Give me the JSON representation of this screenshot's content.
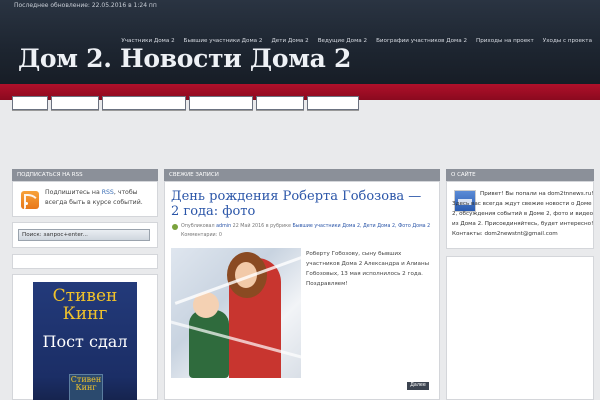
{
  "header": {
    "updated": "Последнее обновление: 22.05.2016 в 1:24 пп",
    "site_title": "Дом 2. Новости Дома 2",
    "nav": [
      "Участники Дома 2",
      "Бывшие участники Дома 2",
      "Дети Дома 2",
      "Ведущие Дома 2",
      "Биографии участников Дома 2",
      "Приходы на проект",
      "Уходы с проекта"
    ]
  },
  "colors": {
    "header_bg": "#1d2530",
    "red_bar": "#a00e26",
    "panel_head": "#8b9099",
    "link": "#2a55a8"
  },
  "sidebar_left": {
    "rss_heading": "Подписаться на RSS",
    "rss_text_before": "Подпишитесь на ",
    "rss_link": "RSS",
    "rss_text_after": ", чтобы всегда быть в курсе событий.",
    "search_value": "Поиск: запрос+enter...",
    "book_author": "Стивен Кинг",
    "book_title": "Пост сдал",
    "book_small_author": "Стивен Кинг"
  },
  "main": {
    "heading": "Свежие записи",
    "post": {
      "title": "День рождения Роберта Гобозова — 2 года: фото",
      "meta_prefix": "Опубликовал ",
      "author": "admin",
      "meta_date": " 22 Май 2016 в рубрике ",
      "categories": "Бывшие участники Дома 2, Дети Дома 2, Фото Дома 2",
      "comments": "Комментарии: 0",
      "excerpt": "Роберту Гобозову, сыну бывших участников Дома 2 Александра и Алианы Гобозовых, 13 мая исполнилось 2 года. Поздравляем!",
      "more": "Далее"
    }
  },
  "sidebar_right": {
    "heading": "О сайте",
    "about": "Привет! Вы попали на dom2tnnews.ru! Здесь вас всегда ждут свежие новости о Доме 2, обсуждения событий в Доме 2, фото и видео из Дома 2. Присоединяйтесь, будет интересно! Контакты: dom2newstnt@gmail.com"
  },
  "icons": [
    "rss-icon",
    "check-icon",
    "site-logo-icon"
  ]
}
